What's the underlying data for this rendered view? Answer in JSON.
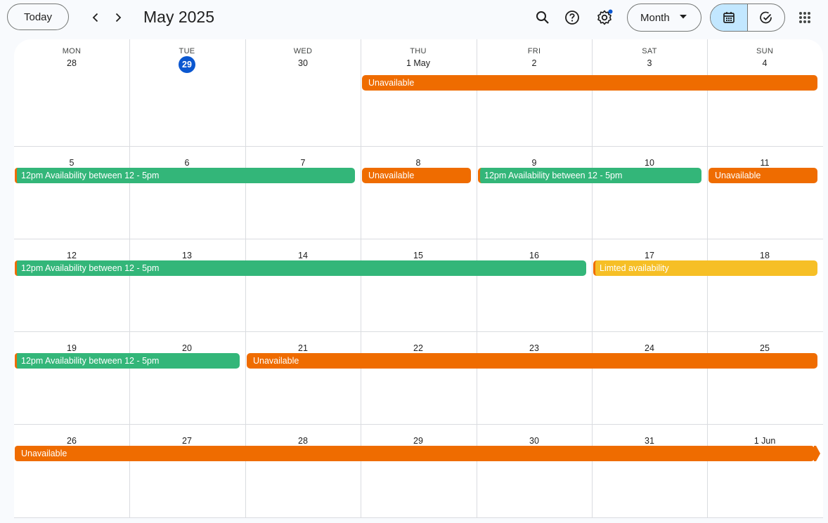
{
  "toolbar": {
    "today_label": "Today",
    "title": "May 2025",
    "view_select": "Month",
    "icons": {
      "prev": "chevron-left-icon",
      "next": "chevron-right-icon",
      "search": "search-icon",
      "help": "help-icon",
      "settings": "settings-icon",
      "calendar": "calendar-icon",
      "tasks": "task-check-icon",
      "apps": "apps-grid-icon"
    }
  },
  "colors": {
    "accent": "#0b57d0",
    "unavailable": "#ef6c00",
    "availability": "#33b679",
    "limited": "#f6bf26",
    "active_toggle": "#c2e7ff"
  },
  "weekdays": [
    "MON",
    "TUE",
    "WED",
    "THU",
    "FRI",
    "SAT",
    "SUN"
  ],
  "weeks": [
    [
      "28",
      "29",
      "30",
      "1 May",
      "2",
      "3",
      "4"
    ],
    [
      "5",
      "6",
      "7",
      "8",
      "9",
      "10",
      "11"
    ],
    [
      "12",
      "13",
      "14",
      "15",
      "16",
      "17",
      "18"
    ],
    [
      "19",
      "20",
      "21",
      "22",
      "23",
      "24",
      "25"
    ],
    [
      "26",
      "27",
      "28",
      "29",
      "30",
      "31",
      "1 Jun"
    ]
  ],
  "today": {
    "week": 0,
    "day": 1
  },
  "events": [
    {
      "week": 0,
      "start": 3,
      "span": 4,
      "title": "Unavailable",
      "kind": "orange"
    },
    {
      "week": 1,
      "start": 0,
      "span": 3,
      "title": "12pm Availability between 12 - 5pm",
      "kind": "green"
    },
    {
      "week": 1,
      "start": 3,
      "span": 1,
      "title": "Unavailable",
      "kind": "orange"
    },
    {
      "week": 1,
      "start": 4,
      "span": 2,
      "title": "12pm Availability between 12 - 5pm",
      "kind": "green"
    },
    {
      "week": 1,
      "start": 6,
      "span": 1,
      "title": "Unavailable",
      "kind": "orange"
    },
    {
      "week": 2,
      "start": 0,
      "span": 5,
      "title": "12pm Availability between 12 - 5pm",
      "kind": "green"
    },
    {
      "week": 2,
      "start": 5,
      "span": 2,
      "title": "Limted availability",
      "kind": "yellow"
    },
    {
      "week": 3,
      "start": 0,
      "span": 2,
      "title": "12pm Availability between 12 - 5pm",
      "kind": "green"
    },
    {
      "week": 3,
      "start": 2,
      "span": 5,
      "title": "Unavailable",
      "kind": "orange"
    },
    {
      "week": 4,
      "start": 0,
      "span": 7,
      "title": "Unavailable",
      "kind": "orange",
      "continues": true
    }
  ]
}
